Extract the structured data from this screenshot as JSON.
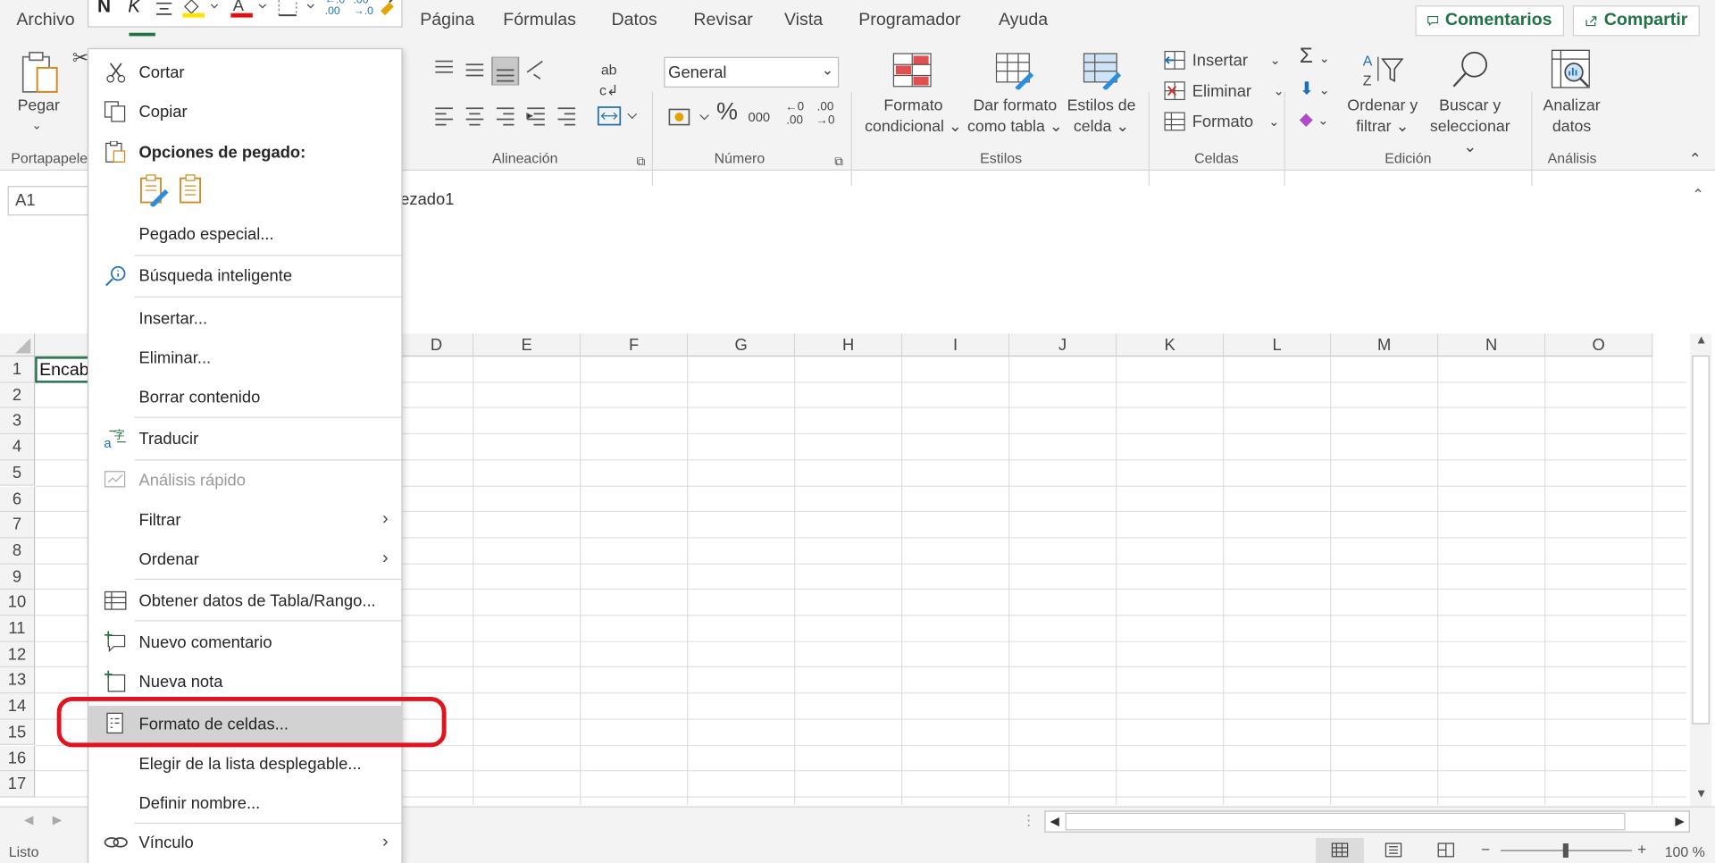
{
  "tabs": [
    "Archivo",
    "Página",
    "Fórmulas",
    "Datos",
    "Revisar",
    "Vista",
    "Programador",
    "Ayuda"
  ],
  "top_buttons": {
    "comments": "Comentarios",
    "share": "Compartir"
  },
  "ribbon": {
    "paste": "Pegar",
    "groups": {
      "clipboard": "Portapapeles",
      "alignment": "Alineación",
      "number": "Número",
      "styles": "Estilos",
      "cells": "Celdas",
      "editing": "Edición",
      "analysis": "Análisis"
    },
    "number_format": "General",
    "conditional_format": [
      "Formato",
      "condicional"
    ],
    "format_table": [
      "Dar formato",
      "como tabla"
    ],
    "cell_styles": [
      "Estilos de",
      "celda"
    ],
    "insert": "Insertar",
    "delete": "Eliminar",
    "format": "Formato",
    "sort_filter": [
      "Ordenar y",
      "filtrar"
    ],
    "find_select": [
      "Buscar y",
      "seleccionar"
    ],
    "analyze_data": [
      "Analizar",
      "datos"
    ]
  },
  "name_box": "A1",
  "formula_text": "ezado1",
  "cell_a1": "Encab",
  "columns": [
    "D",
    "E",
    "F",
    "G",
    "H",
    "I",
    "J",
    "K",
    "L",
    "M",
    "N",
    "O"
  ],
  "rows": [
    "1",
    "2",
    "3",
    "4",
    "5",
    "6",
    "7",
    "8",
    "9",
    "10",
    "11",
    "12",
    "13",
    "14",
    "15",
    "16",
    "17"
  ],
  "status": {
    "ready": "Listo",
    "zoom": "100 %"
  },
  "context_menu": {
    "cut": "Cortar",
    "copy": "Copiar",
    "paste_options": "Opciones de pegado:",
    "paste_special": "Pegado especial...",
    "smart_lookup": "Búsqueda inteligente",
    "insert": "Insertar...",
    "delete": "Eliminar...",
    "clear": "Borrar contenido",
    "translate": "Traducir",
    "quick_analysis": "Análisis rápido",
    "filter": "Filtrar",
    "sort": "Ordenar",
    "get_data": "Obtener datos de Tabla/Rango...",
    "new_comment": "Nuevo comentario",
    "new_note": "Nueva nota",
    "format_cells": "Formato de celdas...",
    "pick_list": "Elegir de la lista desplegable...",
    "define_name": "Definir nombre...",
    "link": "Vínculo"
  },
  "mini_toolbar": {
    "bold": "N",
    "italic": "K",
    "inc_decimals": "←.0\n.00",
    "dec_decimals": ".00\n→.0"
  },
  "colors": {
    "excel_green": "#217346",
    "highlight_red": "#e0141e",
    "menu_highlight": "#d2d2d2"
  }
}
